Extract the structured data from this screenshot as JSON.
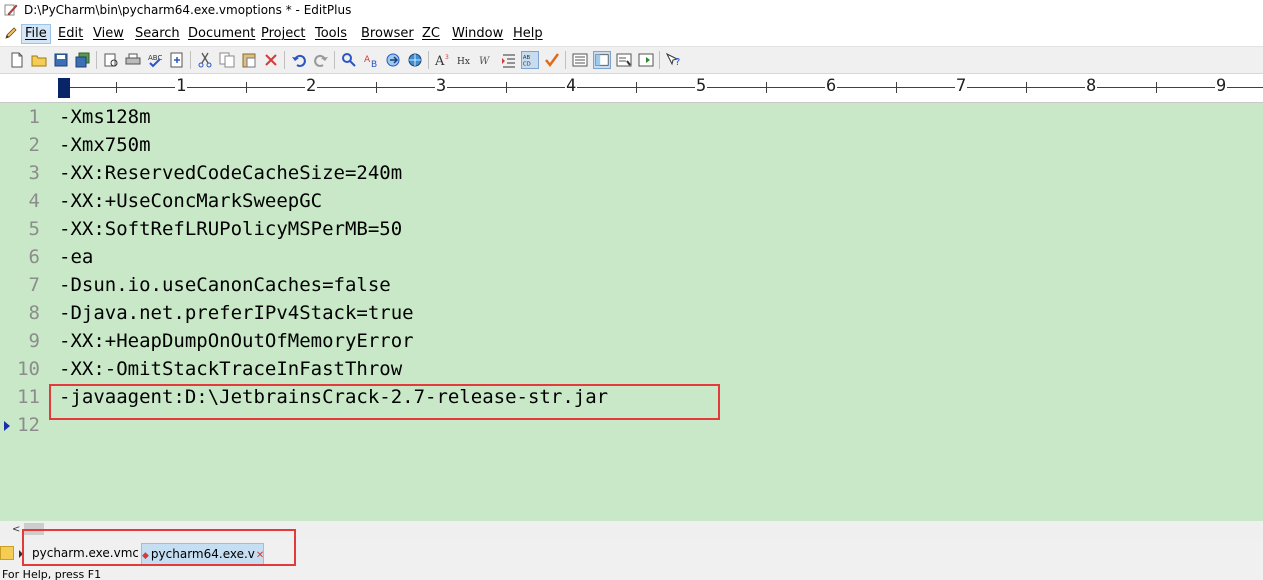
{
  "window": {
    "title": "D:\\PyCharm\\bin\\pycharm64.exe.vmoptions * - EditPlus"
  },
  "menu": [
    "File",
    "Edit",
    "View",
    "Search",
    "Document",
    "Project",
    "Tools",
    "Browser",
    "ZC",
    "Window",
    "Help"
  ],
  "toolbar_icons": [
    "new-file-icon",
    "open-folder-icon",
    "save-icon",
    "save-all-icon",
    "print-preview-icon",
    "print-icon",
    "spellcheck-icon",
    "find-in-files-icon",
    "ftp-icon",
    "cut-icon",
    "copy-icon",
    "paste-icon",
    "delete-icon",
    "undo-icon",
    "redo-icon",
    "find-icon",
    "replace-icon",
    "goto-icon",
    "browser-icon",
    "font-icon",
    "hex-icon",
    "word-wrap-icon",
    "indent-icon",
    "column-select-icon",
    "check-icon",
    "view-1-icon",
    "view-2-icon",
    "view-3-icon",
    "view-4-icon",
    "help-icon"
  ],
  "ruler": {
    "numbers": [
      "1",
      "2",
      "3",
      "4",
      "5",
      "6",
      "7",
      "8",
      "9"
    ]
  },
  "editor": {
    "lines": [
      {
        "num": "1",
        "text": "-Xms128m"
      },
      {
        "num": "2",
        "text": "-Xmx750m"
      },
      {
        "num": "3",
        "text": "-XX:ReservedCodeCacheSize=240m"
      },
      {
        "num": "4",
        "text": "-XX:+UseConcMarkSweepGC"
      },
      {
        "num": "5",
        "text": "-XX:SoftRefLRUPolicyMSPerMB=50"
      },
      {
        "num": "6",
        "text": "-ea"
      },
      {
        "num": "7",
        "text": "-Dsun.io.useCanonCaches=false"
      },
      {
        "num": "8",
        "text": "-Djava.net.preferIPv4Stack=true"
      },
      {
        "num": "9",
        "text": "-XX:+HeapDumpOnOutOfMemoryError"
      },
      {
        "num": "10",
        "text": "-XX:-OmitStackTraceInFastThrow"
      },
      {
        "num": "11",
        "text": "-javaagent:D:\\JetbrainsCrack-2.7-release-str.jar"
      },
      {
        "num": "12",
        "text": ""
      }
    ],
    "background": "#c8e8c8",
    "highlight_color": "#e33b3b"
  },
  "tabs": [
    {
      "label": "pycharm.exe.vmc",
      "active": false
    },
    {
      "label": "pycharm64.exe.v",
      "active": true
    }
  ],
  "status": {
    "text": "For Help, press F1"
  }
}
